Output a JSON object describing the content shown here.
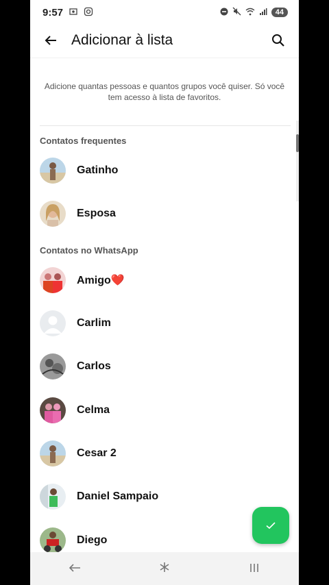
{
  "status": {
    "time": "9:57",
    "battery": "44",
    "left_icons": [
      "screenshot-icon",
      "instagram-icon"
    ],
    "right_icons": [
      "dnd-icon",
      "mute-icon",
      "wifi-icon",
      "signal-icon"
    ]
  },
  "appbar": {
    "title": "Adicionar à lista"
  },
  "info_text": "Adicione quantas pessoas e quantos grupos você quiser. Só você tem acesso à lista de favoritos.",
  "sections": {
    "frequent": "Contatos frequentes",
    "whatsapp": "Contatos no WhatsApp"
  },
  "frequent_contacts": [
    {
      "name": "Gatinho",
      "avatar": "photo-person-beach"
    },
    {
      "name": "Esposa",
      "avatar": "photo-woman"
    }
  ],
  "whatsapp_contacts": [
    {
      "name": "Amigo❤️",
      "avatar": "photo-group-red"
    },
    {
      "name": "Carlim",
      "avatar": "default-avatar"
    },
    {
      "name": "Carlos",
      "avatar": "photo-bw"
    },
    {
      "name": "Celma",
      "avatar": "photo-two-people"
    },
    {
      "name": "Cesar 2",
      "avatar": "photo-person-beach"
    },
    {
      "name": "Daniel Sampaio",
      "avatar": "photo-person-green"
    },
    {
      "name": "Diego",
      "avatar": "photo-motorbike"
    }
  ],
  "colors": {
    "accent": "#22c55e",
    "background": "#ffffff"
  },
  "nav": [
    "back-icon",
    "home-icon",
    "recents-icon"
  ]
}
